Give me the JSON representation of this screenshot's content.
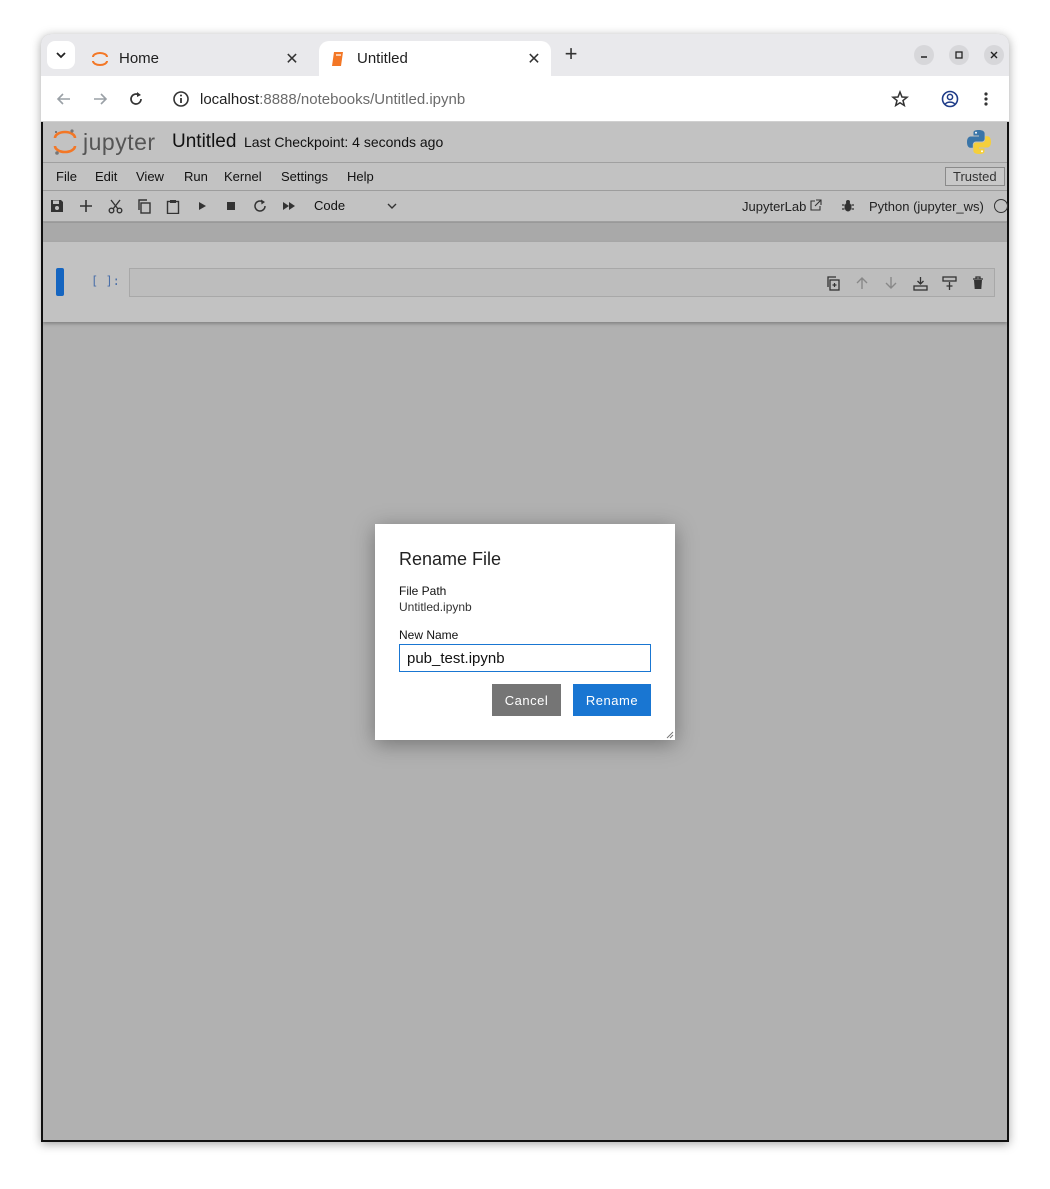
{
  "browser": {
    "tabs": [
      {
        "title": "Home",
        "favicon": "jupyter-icon",
        "active": false
      },
      {
        "title": "Untitled",
        "favicon": "notebook-icon",
        "active": true
      }
    ],
    "close_glyph": "✕",
    "new_tab_glyph": "+",
    "url_host": "localhost",
    "url_rest": ":8888/notebooks/Untitled.ipynb"
  },
  "jupyter": {
    "logo_text": "jupyter",
    "notebook_title": "Untitled",
    "checkpoint": "Last Checkpoint: 4 seconds ago",
    "menu": [
      "File",
      "Edit",
      "View",
      "Run",
      "Kernel",
      "Settings",
      "Help"
    ],
    "trusted": "Trusted",
    "cell_type": "Code",
    "jupyterlab_link": "JupyterLab",
    "kernel": "Python (jupyter_ws)",
    "cell_prompt": "[ ]:",
    "accent": "#1565c0"
  },
  "dialog": {
    "title": "Rename File",
    "file_path_label": "File Path",
    "file_path_value": "Untitled.ipynb",
    "new_name_label": "New Name",
    "new_name_value": "pub_test.ipynb",
    "cancel_label": "Cancel",
    "rename_label": "Rename",
    "accent": "#1976d2"
  }
}
